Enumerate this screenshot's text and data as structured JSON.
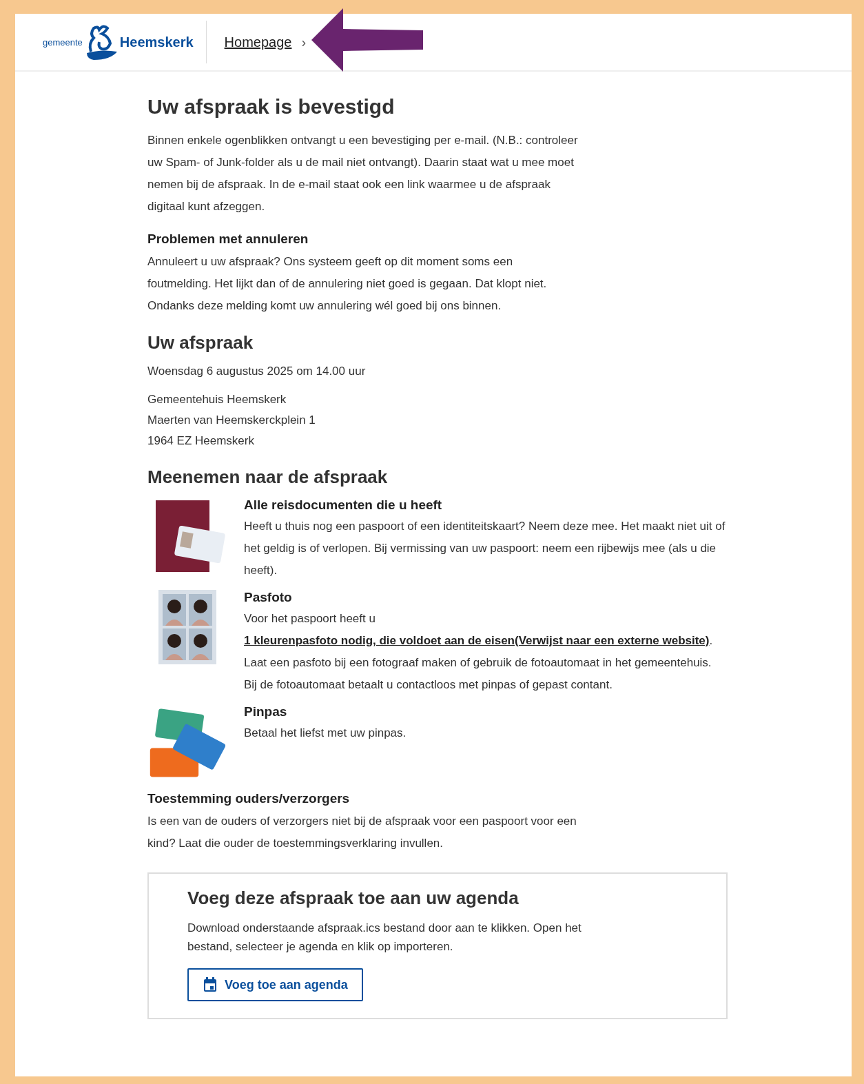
{
  "header": {
    "logo": {
      "prefix": "gemeente",
      "name": "Heemskerk"
    },
    "breadcrumb": [
      {
        "label": "Homepage"
      }
    ],
    "separator": "›"
  },
  "title": "Uw afspraak is bevestigd",
  "intro": "Binnen enkele ogenblikken ontvangt u een bevestiging per e-mail. (N.B.: controleer uw Spam- of Junk-folder als u de mail niet ontvangt). Daarin staat wat u mee moet nemen bij de afspraak. In de e-mail staat ook een link waarmee u de afspraak digitaal kunt afzeggen.",
  "notice": {
    "heading": "Problemen met annuleren",
    "text": "Annuleert u uw afspraak? Ons systeem geeft op dit moment soms een foutmelding. Het lijkt dan of de annulering niet goed is gegaan. Dat klopt niet. Ondanks deze melding komt uw annulering wél goed bij ons binnen."
  },
  "appointment": {
    "heading": "Uw afspraak",
    "datetime": "Woensdag 6 augustus 2025 om 14.00 uur",
    "address": [
      "Gemeentehuis Heemskerk",
      "Maerten van Heemskerckplein 1",
      "1964 EZ Heemskerk"
    ]
  },
  "bring": {
    "heading": "Meenemen naar de afspraak",
    "items": [
      {
        "kind": "documents",
        "title": "Alle reisdocumenten die u heeft",
        "before": "Heeft u thuis nog een paspoort of een identiteitskaart? Neem deze mee. Het maakt niet uit of het geldig is of verlopen. Bij vermissing van uw paspoort: neem een rijbewijs mee (als u die heeft)."
      },
      {
        "kind": "photo",
        "title": "Pasfoto",
        "before": "Voor het paspoort heeft u ",
        "link": "1 kleurenpasfoto nodig, die voldoet aan de eisen(Verwijst naar een externe website)",
        "after": ". Laat een pasfoto bij een fotograaf maken of gebruik de fotoautomaat in het gemeentehuis. Bij de fotoautomaat betaalt u contactloos met pinpas of gepast contant."
      },
      {
        "kind": "cards",
        "title": "Pinpas",
        "before": "Betaal het liefst met uw pinpas."
      }
    ]
  },
  "consent": {
    "heading": "Toestemming ouders/verzorgers",
    "text": "Is een van de ouders of verzorgers niet bij de afspraak voor een paspoort voor een kind? Laat die ouder de toestemmingsverklaring invullen."
  },
  "calendar": {
    "heading": "Voeg deze afspraak toe aan uw agenda",
    "text": "Download onderstaande afspraak.ics bestand door aan te klikken. Open het bestand, selecteer je agenda en klik op importeren.",
    "button": "Voeg toe aan agenda"
  }
}
